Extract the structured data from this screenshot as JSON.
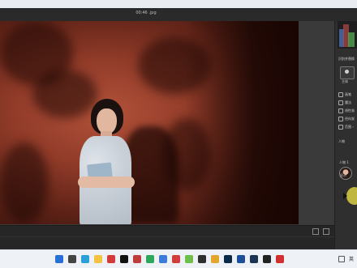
{
  "app": {
    "tab_title": "00:46 .jpg"
  },
  "panel": {
    "section_title": "识别并替换",
    "person_label": "主体",
    "tools": [
      {
        "label": "画笔",
        "icon": "brush-icon"
      },
      {
        "label": "魔法",
        "icon": "magic-icon"
      },
      {
        "label": "线性渐",
        "icon": "gradient-icon"
      },
      {
        "label": "径向渐",
        "icon": "radial-icon"
      },
      {
        "label": "范围 ›",
        "icon": "range-icon"
      }
    ],
    "people_header": "人物",
    "person_item": "人物 1",
    "hint": "显示"
  },
  "taskbar": {
    "icons": [
      {
        "name": "windows-start-icon",
        "color": "#2a6fd6"
      },
      {
        "name": "search-icon",
        "color": "#444444"
      },
      {
        "name": "edge-icon",
        "color": "#2b9fd8"
      },
      {
        "name": "files-icon",
        "color": "#f3c33f"
      },
      {
        "name": "app-icon",
        "color": "#d33a3a"
      },
      {
        "name": "capcut-icon",
        "color": "#111111"
      },
      {
        "name": "app-icon",
        "color": "#c03b3b"
      },
      {
        "name": "app-icon",
        "color": "#2fa75a"
      },
      {
        "name": "app-icon",
        "color": "#3b7dd8"
      },
      {
        "name": "app-icon",
        "color": "#d23c3c"
      },
      {
        "name": "camtasia-icon",
        "color": "#6cc04a"
      },
      {
        "name": "app-icon",
        "color": "#2f2f2f"
      },
      {
        "name": "chrome-icon",
        "color": "#e1a72b"
      },
      {
        "name": "photoshop-icon",
        "color": "#0b2a4a"
      },
      {
        "name": "app-icon",
        "color": "#1e4f9a"
      },
      {
        "name": "lightroom-icon",
        "color": "#1c3554"
      },
      {
        "name": "app-icon",
        "color": "#222222"
      },
      {
        "name": "app-icon",
        "color": "#d22f2f"
      }
    ],
    "lang": "英"
  }
}
